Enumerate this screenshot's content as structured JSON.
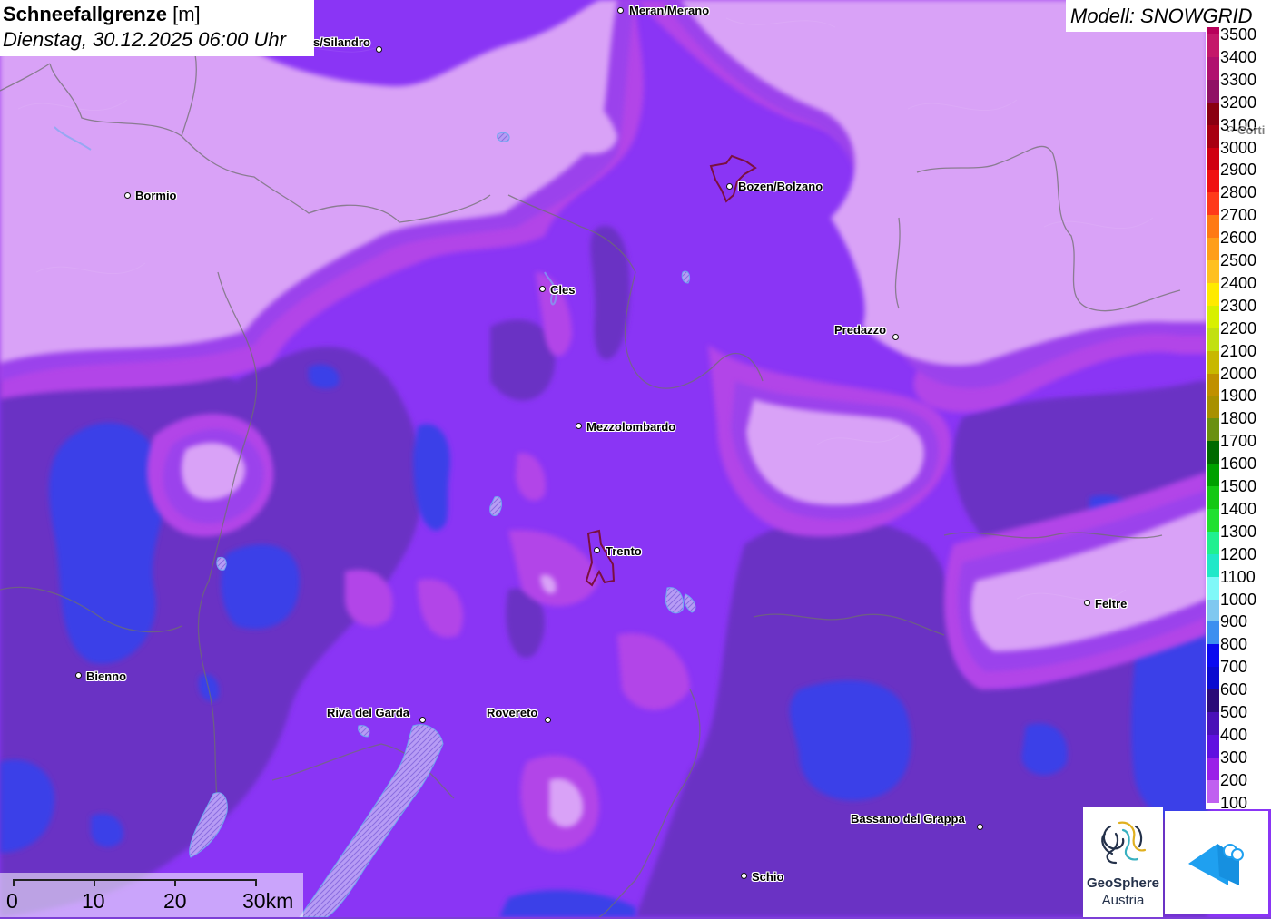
{
  "header": {
    "title": "Schneefallgrenze",
    "unit": "[m]",
    "datetime": "Dienstag, 30.12.2025 06:00 Uhr"
  },
  "model": {
    "label": "Modell: SNOWGRID"
  },
  "legend": {
    "items": [
      {
        "value": "3500",
        "color": "#b8005a"
      },
      {
        "value": "3400",
        "color": "#c4186a"
      },
      {
        "value": "3300",
        "color": "#b0106e"
      },
      {
        "value": "3200",
        "color": "#901064"
      },
      {
        "value": "3100",
        "color": "#8a0010"
      },
      {
        "value": "3000",
        "color": "#a80010"
      },
      {
        "value": "2900",
        "color": "#d00010"
      },
      {
        "value": "2800",
        "color": "#f01010"
      },
      {
        "value": "2700",
        "color": "#ff3a1a"
      },
      {
        "value": "2600",
        "color": "#ff7a14"
      },
      {
        "value": "2500",
        "color": "#ff9e1a"
      },
      {
        "value": "2400",
        "color": "#ffc020"
      },
      {
        "value": "2300",
        "color": "#ffea00"
      },
      {
        "value": "2200",
        "color": "#d8f000"
      },
      {
        "value": "2100",
        "color": "#c2e010"
      },
      {
        "value": "2000",
        "color": "#c8b800"
      },
      {
        "value": "1900",
        "color": "#c09000"
      },
      {
        "value": "1800",
        "color": "#a89000"
      },
      {
        "value": "1700",
        "color": "#6a9010"
      },
      {
        "value": "1600",
        "color": "#006a00"
      },
      {
        "value": "1500",
        "color": "#00a000"
      },
      {
        "value": "1400",
        "color": "#14c814"
      },
      {
        "value": "1300",
        "color": "#20e030"
      },
      {
        "value": "1200",
        "color": "#20f090"
      },
      {
        "value": "1100",
        "color": "#20e8c8"
      },
      {
        "value": "1000",
        "color": "#80f8f8"
      },
      {
        "value": "900",
        "color": "#80c8f0"
      },
      {
        "value": "800",
        "color": "#3c8ff0"
      },
      {
        "value": "700",
        "color": "#0a0af0"
      },
      {
        "value": "600",
        "color": "#0a0ad0"
      },
      {
        "value": "500",
        "color": "#2a0a78"
      },
      {
        "value": "400",
        "color": "#4a10b8"
      },
      {
        "value": "300",
        "color": "#6010e0"
      },
      {
        "value": "200",
        "color": "#9a20e8"
      },
      {
        "value": "100",
        "color": "#c060f0"
      }
    ]
  },
  "cities": [
    {
      "name": "Meran/Merano"
    },
    {
      "name": "s/Silandro"
    },
    {
      "name": "Bormio"
    },
    {
      "name": "Bozen/Bolzano"
    },
    {
      "name": "Cles"
    },
    {
      "name": "Predazzo"
    },
    {
      "name": "Mezzolombardo"
    },
    {
      "name": "Trento"
    },
    {
      "name": "Feltre"
    },
    {
      "name": "Bienno"
    },
    {
      "name": "Riva del Garda"
    },
    {
      "name": "Rovereto"
    },
    {
      "name": "Bassano del Grappa"
    },
    {
      "name": "Schio"
    },
    {
      "name": "Corti"
    }
  ],
  "scalebar": {
    "labels": [
      "0",
      "10",
      "20",
      "30km"
    ]
  },
  "logos": {
    "geosphere_name": "GeoSphere",
    "geosphere_sub": "Austria"
  },
  "colors": {
    "pale_high": "#d9a2f7",
    "magenta_band": "#b245e8",
    "mid_purple": "#9030f0",
    "violet": "#8a35f5",
    "dark_purple": "#6a30c4",
    "blue": "#3a40e8",
    "pink_spot": "#c048e0"
  }
}
